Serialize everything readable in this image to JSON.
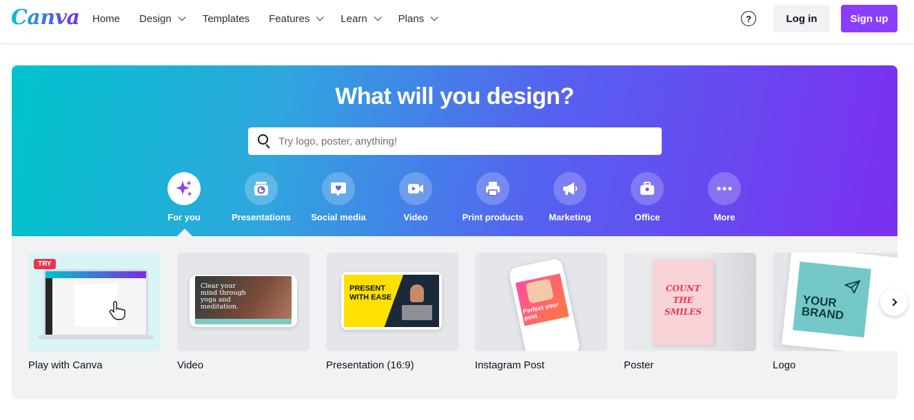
{
  "header": {
    "logo": "Canva",
    "nav": [
      {
        "label": "Home",
        "dropdown": false
      },
      {
        "label": "Design",
        "dropdown": true
      },
      {
        "label": "Templates",
        "dropdown": false
      },
      {
        "label": "Features",
        "dropdown": true
      },
      {
        "label": "Learn",
        "dropdown": true
      },
      {
        "label": "Plans",
        "dropdown": true
      }
    ],
    "help_glyph": "?",
    "login_label": "Log in",
    "signup_label": "Sign up"
  },
  "hero": {
    "title": "What will you design?",
    "search_placeholder": "Try logo, poster, anything!",
    "categories": [
      {
        "label": "For you",
        "icon": "sparkles-icon",
        "active": true
      },
      {
        "label": "Presentations",
        "icon": "presentation-icon",
        "active": false
      },
      {
        "label": "Social media",
        "icon": "heart-chat-icon",
        "active": false
      },
      {
        "label": "Video",
        "icon": "video-camera-icon",
        "active": false
      },
      {
        "label": "Print products",
        "icon": "printer-icon",
        "active": false
      },
      {
        "label": "Marketing",
        "icon": "megaphone-icon",
        "active": false
      },
      {
        "label": "Office",
        "icon": "briefcase-icon",
        "active": false
      },
      {
        "label": "More",
        "icon": "more-dots-icon",
        "active": false
      }
    ]
  },
  "designs": {
    "try_badge": "TRY",
    "items": [
      {
        "label": "Play with Canva"
      },
      {
        "label": "Video",
        "thumb_text": "Clear your mind through yoga and meditation."
      },
      {
        "label": "Presentation (16:9)",
        "thumb_text": "PRESENT WITH EASE"
      },
      {
        "label": "Instagram Post",
        "thumb_text": "Perfect your post"
      },
      {
        "label": "Poster",
        "thumb_text": "COUNT THE SMILES"
      },
      {
        "label": "Logo",
        "thumb_text": "YOUR BRAND"
      }
    ]
  },
  "colors": {
    "brand_purple": "#8b3dff",
    "hero_gradient_start": "#00c4cc",
    "hero_gradient_end": "#7b2ff0",
    "try_red": "#e8344e"
  }
}
